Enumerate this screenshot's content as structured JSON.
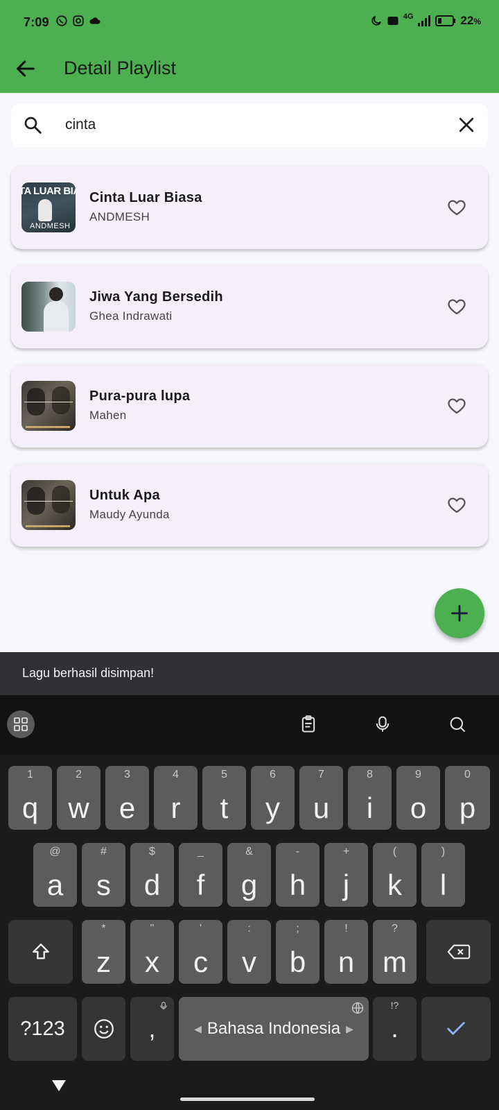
{
  "status": {
    "time": "7:09",
    "battery": "22",
    "battery_unit": "%",
    "network": "4G"
  },
  "appbar": {
    "title": "Detail Playlist"
  },
  "search": {
    "value": "cinta",
    "placeholder": ""
  },
  "songs": [
    {
      "title": "Cinta Luar Biasa",
      "artist": "ANDMESH",
      "cover_text_top": "TA LUAR BIA",
      "cover_text_bottom": "ANDMESH"
    },
    {
      "title": "Jiwa Yang Bersedih",
      "artist": "Ghea Indrawati"
    },
    {
      "title": "Pura-pura lupa",
      "artist": "Mahen"
    },
    {
      "title": "Untuk Apa",
      "artist": "Maudy Ayunda"
    }
  ],
  "snackbar": {
    "message": "Lagu berhasil disimpan!"
  },
  "keyboard": {
    "row1": [
      {
        "k": "q",
        "h": "1"
      },
      {
        "k": "w",
        "h": "2"
      },
      {
        "k": "e",
        "h": "3"
      },
      {
        "k": "r",
        "h": "4"
      },
      {
        "k": "t",
        "h": "5"
      },
      {
        "k": "y",
        "h": "6"
      },
      {
        "k": "u",
        "h": "7"
      },
      {
        "k": "i",
        "h": "8"
      },
      {
        "k": "o",
        "h": "9"
      },
      {
        "k": "p",
        "h": "0"
      }
    ],
    "row2": [
      {
        "k": "a",
        "h": "@"
      },
      {
        "k": "s",
        "h": "#"
      },
      {
        "k": "d",
        "h": "$"
      },
      {
        "k": "f",
        "h": "_"
      },
      {
        "k": "g",
        "h": "&"
      },
      {
        "k": "h",
        "h": "-"
      },
      {
        "k": "j",
        "h": "+"
      },
      {
        "k": "k",
        "h": "("
      },
      {
        "k": "l",
        "h": ")"
      }
    ],
    "row3": [
      {
        "k": "z",
        "h": "*"
      },
      {
        "k": "x",
        "h": "\""
      },
      {
        "k": "c",
        "h": "'"
      },
      {
        "k": "v",
        "h": ":"
      },
      {
        "k": "b",
        "h": ";"
      },
      {
        "k": "n",
        "h": "!"
      },
      {
        "k": "m",
        "h": "?"
      }
    ],
    "symbols_label": "?123",
    "comma": ",",
    "space_label": "Bahasa Indonesia",
    "period": ".",
    "period_hint": "!?"
  }
}
